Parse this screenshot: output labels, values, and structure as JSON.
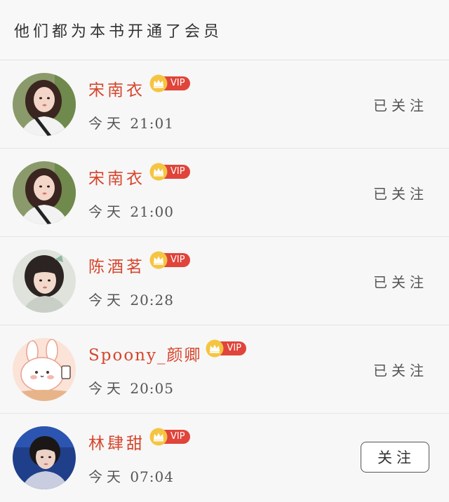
{
  "header": {
    "title": "他们都为本书开通了会员"
  },
  "colors": {
    "name": "#d6452c",
    "vip_badge": "#e0443a",
    "crown": "#f5c542"
  },
  "vip_label": "VIP",
  "members": [
    {
      "name": "宋南衣",
      "time_day": "今天",
      "time": "21:01",
      "action": "已关注",
      "avatar": "girl-dark-hair-icon"
    },
    {
      "name": "宋南衣",
      "time_day": "今天",
      "time": "21:00",
      "action": "已关注",
      "avatar": "girl-dark-hair-icon"
    },
    {
      "name": "陈酒茗",
      "time_day": "今天",
      "time": "20:28",
      "action": "已关注",
      "avatar": "girl-short-hair-icon"
    },
    {
      "name": "Spoony_颜卿",
      "time_day": "今天",
      "time": "20:05",
      "action": "已关注",
      "avatar": "bunny-cartoon-icon"
    },
    {
      "name": "林肆甜",
      "time_day": "今天",
      "time": "07:04",
      "action": "关注",
      "avatar": "boy-portrait-icon"
    }
  ]
}
